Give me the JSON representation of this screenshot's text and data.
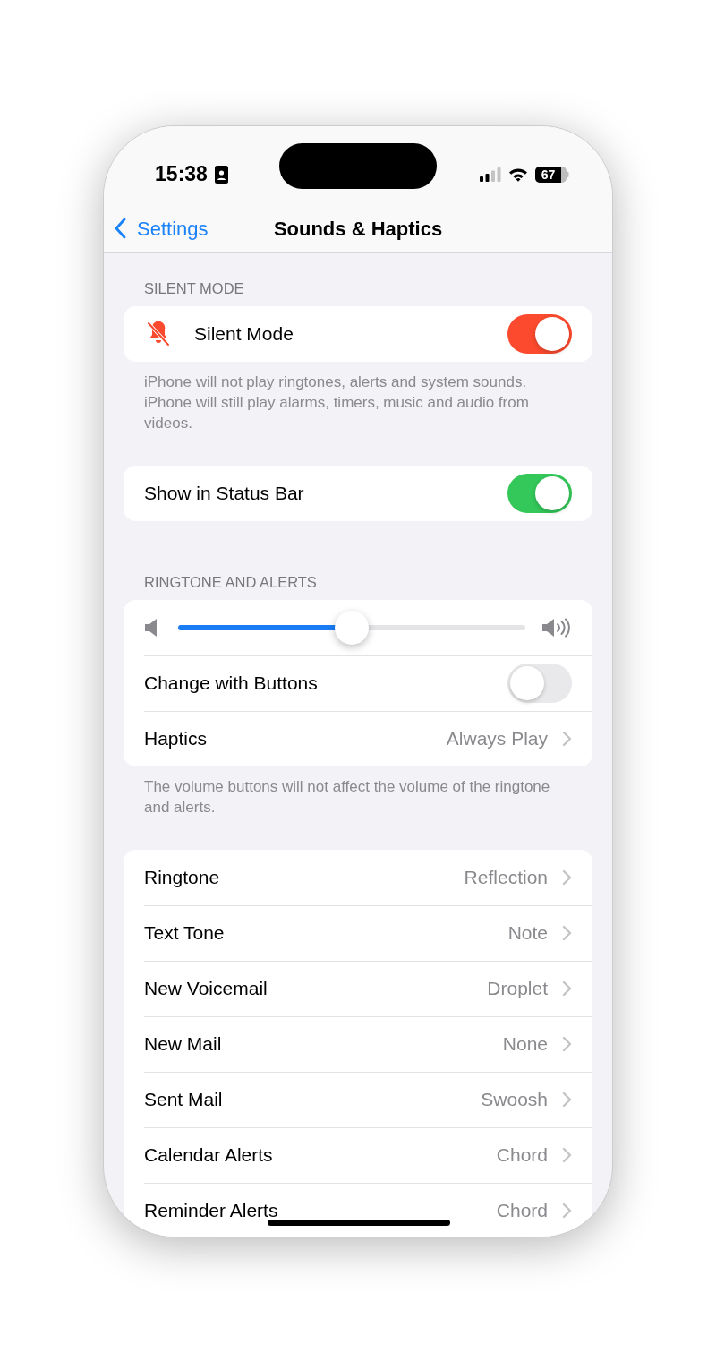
{
  "status_bar": {
    "time": "15:38",
    "battery": "67"
  },
  "nav": {
    "back": "Settings",
    "title": "Sounds & Haptics"
  },
  "sections": [
    {
      "header": "SILENT MODE",
      "rows": [
        {
          "kind": "bell_toggle",
          "label": "Silent Mode",
          "on": true,
          "color": "#fb4a2e"
        }
      ],
      "footer": "iPhone will not play ringtones, alerts and system sounds. iPhone will still play alarms, timers, music and audio from videos."
    },
    {
      "rows": [
        {
          "kind": "toggle",
          "label": "Show in Status Bar",
          "on": true,
          "color": "#34c759"
        }
      ]
    },
    {
      "header": "RINGTONE AND ALERTS",
      "rows": [
        {
          "kind": "slider",
          "level": 0.5
        },
        {
          "kind": "toggle",
          "label": "Change with Buttons",
          "on": false
        },
        {
          "kind": "link",
          "label": "Haptics",
          "value": "Always Play"
        }
      ],
      "footer": "The volume buttons will not affect the volume of the ringtone and alerts."
    },
    {
      "rows": [
        {
          "kind": "link",
          "label": "Ringtone",
          "value": "Reflection"
        },
        {
          "kind": "link",
          "label": "Text Tone",
          "value": "Note"
        },
        {
          "kind": "link",
          "label": "New Voicemail",
          "value": "Droplet"
        },
        {
          "kind": "link",
          "label": "New Mail",
          "value": "None"
        },
        {
          "kind": "link",
          "label": "Sent Mail",
          "value": "Swoosh"
        },
        {
          "kind": "link",
          "label": "Calendar Alerts",
          "value": "Chord"
        },
        {
          "kind": "link",
          "label": "Reminder Alerts",
          "value": "Chord"
        }
      ]
    }
  ]
}
